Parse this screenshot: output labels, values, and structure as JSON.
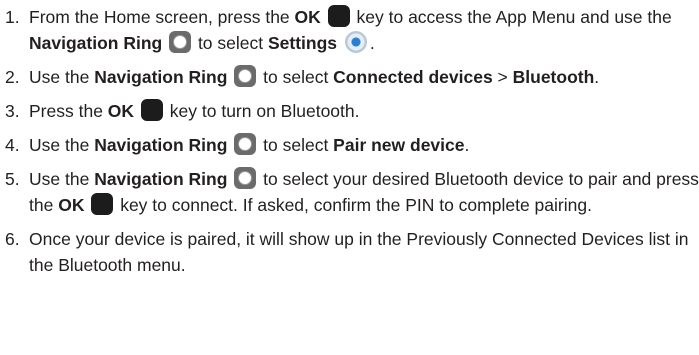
{
  "steps": [
    {
      "num": "1.",
      "t1": "From the Home screen, press the ",
      "b1": "OK",
      "t2": " key to access the App Menu and use the ",
      "b2": "Navigation Ring",
      "t3": " to select ",
      "b3": "Settings",
      "t4": "."
    },
    {
      "num": "2.",
      "t1": "Use the ",
      "b1": "Navigation Ring",
      "t2": " to select ",
      "b2": "Connected devices",
      "t3": " > ",
      "b3": "Bluetooth",
      "t4": "."
    },
    {
      "num": "3.",
      "t1": "Press the ",
      "b1": "OK",
      "t2": " key to turn on Bluetooth."
    },
    {
      "num": "4.",
      "t1": "Use the ",
      "b1": "Navigation Ring",
      "t2": " to select ",
      "b2": "Pair new device",
      "t3": "."
    },
    {
      "num": "5.",
      "t1": "Use the ",
      "b1": "Navigation Ring",
      "t2": " to select your desired Bluetooth device to pair and press the ",
      "b2": "OK",
      "t3": " key to connect. If asked, confirm the PIN to complete pairing."
    },
    {
      "num": "6.",
      "t1": "Once your device is paired, it will show up in the Previously Connected Devices list in the Bluetooth menu."
    }
  ],
  "icons": {
    "ok_key": "ok-key-icon",
    "navigation_ring": "navigation-ring-icon",
    "settings": "settings-gear-icon"
  },
  "colors": {
    "text": "#231f20",
    "ok_key": "#1c1c1c",
    "ring": "#6b6b6b",
    "settings_accent": "#2b7fd1"
  }
}
